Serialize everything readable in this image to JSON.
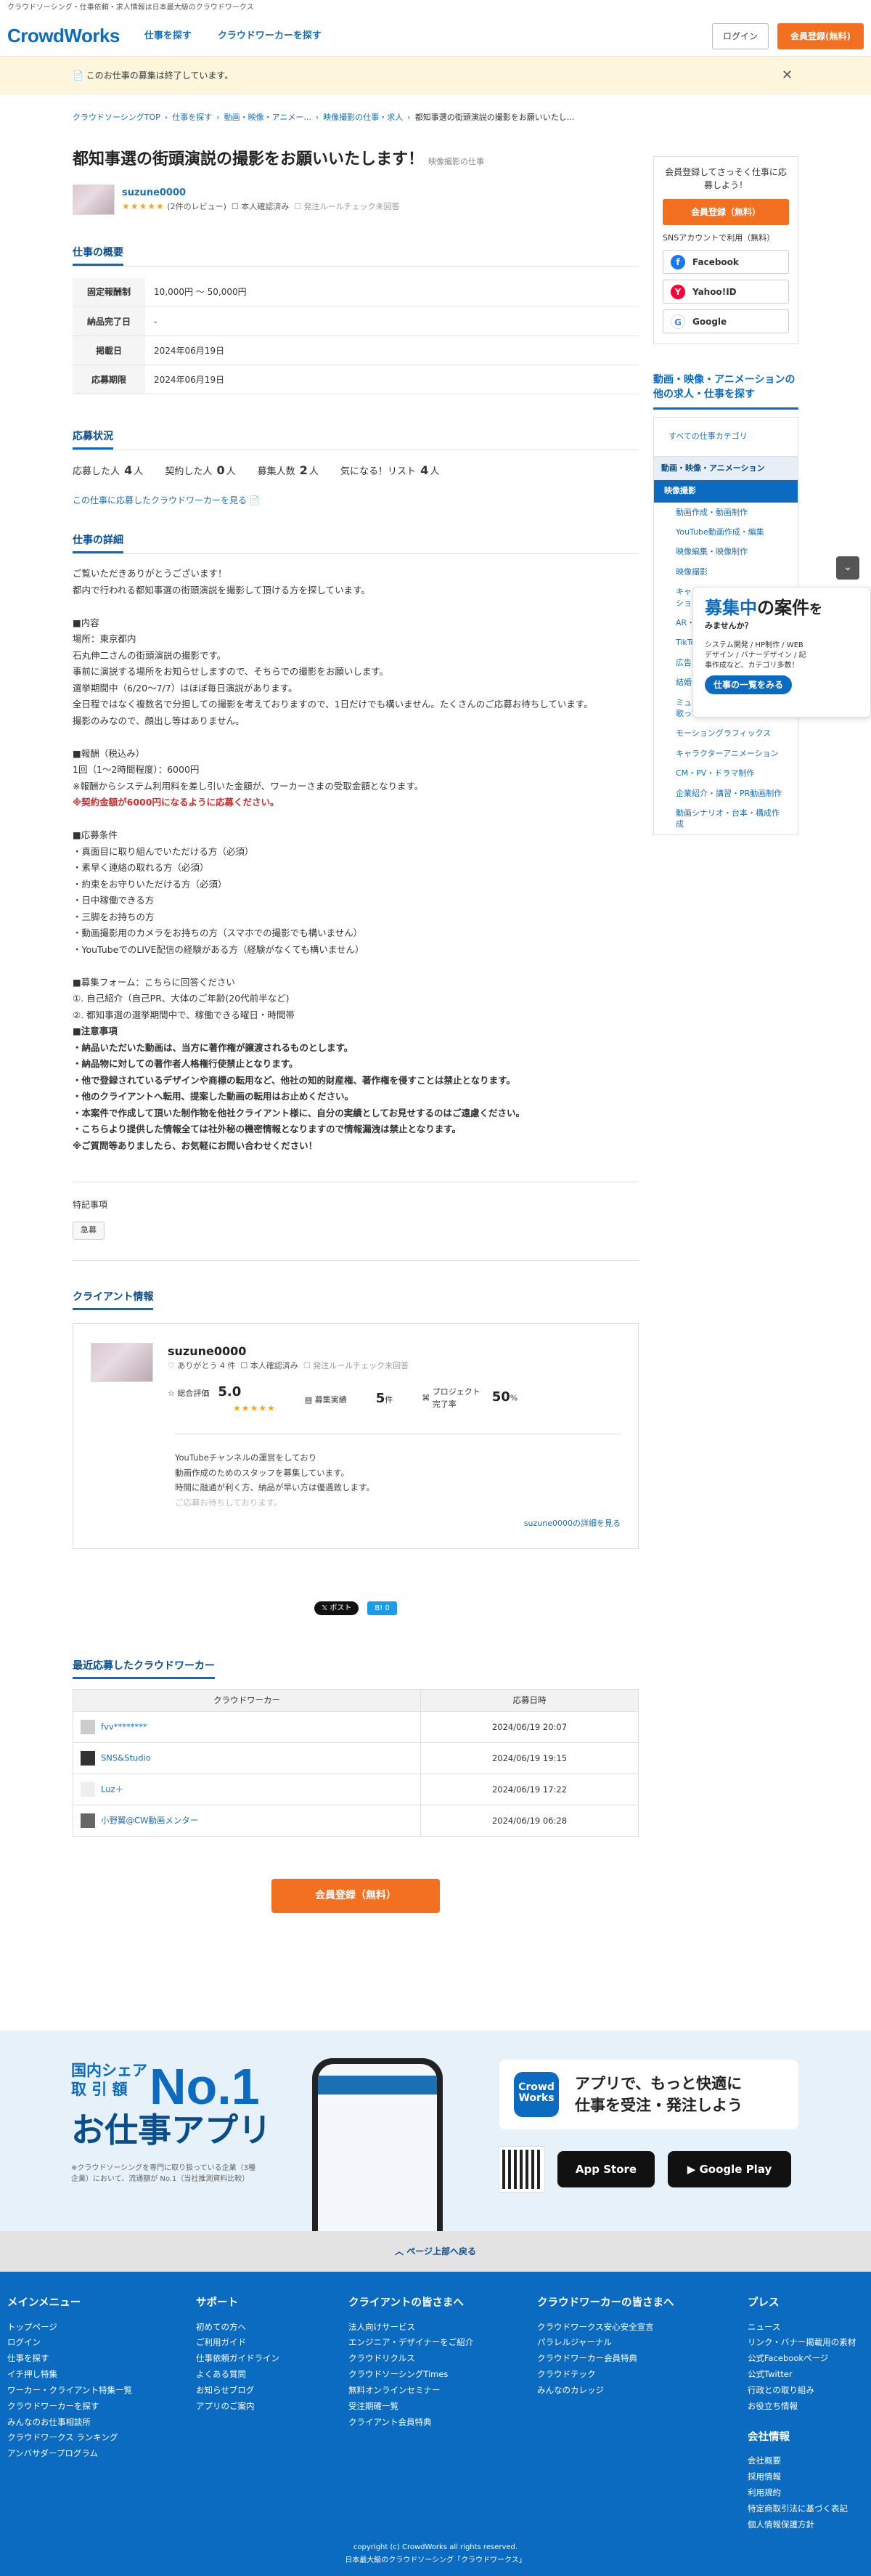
{
  "topbar": "クラウドソーシング・仕事依頼・求人情報は日本最大級のクラウドワークス",
  "header": {
    "logo": "CrowdWorks",
    "nav": [
      "仕事を探す",
      "クラウドワーカーを探す"
    ],
    "login": "ログイン",
    "register": "会員登録(無料)"
  },
  "notice": {
    "text": "📄 このお仕事の募集は終了しています。",
    "close": "✕"
  },
  "breadcrumb": [
    "クラウドソーシングTOP",
    "仕事を探す",
    "動画・映像・アニメー...",
    "映像撮影の仕事・求人",
    "都知事選の街頭演説の撮影をお願いいたし..."
  ],
  "job": {
    "title": "都知事選の街頭演説の撮影をお願いいたします！",
    "category": "映像撮影の仕事",
    "client": {
      "name": "suzune0000",
      "stars": "★★★★★",
      "reviews": "(2件のレビュー)",
      "verified": "本人確認済み",
      "rule": "発注ルールチェック未回答"
    }
  },
  "overview": {
    "title": "仕事の概要",
    "rows": [
      {
        "k": "固定報酬制",
        "v": "10,000円 〜 50,000円"
      },
      {
        "k": "納品完了日",
        "v": "-"
      },
      {
        "k": "掲載日",
        "v": "2024年06月19日"
      },
      {
        "k": "応募期限",
        "v": "2024年06月19日"
      }
    ]
  },
  "status": {
    "title": "応募状況",
    "applicants_label": "応募した人",
    "applicants": "4",
    "applicants_unit": "人",
    "contracted_label": "契約した人",
    "contracted": "0",
    "contracted_unit": "人",
    "recruit_label": "募集人数",
    "recruit": "2",
    "recruit_unit": "人",
    "fav_label": "気になる！リスト",
    "fav": "4",
    "fav_unit": "人",
    "link": "この仕事に応募したクラウドワーカーを見る 📄"
  },
  "detail": {
    "title": "仕事の詳細",
    "p1": "ご覧いただきありがとうございます！\n都内で行われる都知事選の街頭演説を撮影して頂ける方を探しています。\n\n■内容\n場所：東京都内\n石丸伸二さんの街頭演説の撮影です。\n事前に演説する場所をお知らせしますので、そちらでの撮影をお願いします。\n選挙期間中（6/20〜7/7）はほぼ毎日演説があります。\n全日程ではなく複数名で分担しての撮影を考えておりますので、1日だけでも構いません。たくさんのご応募お待ちしています。\n撮影のみなので、顔出し等はありません。\n\n■報酬（税込み）\n1回（1〜2時間程度）：6000円\n※報酬からシステム利用料を差し引いた金額が、ワーカーさまの受取金額となります。",
    "red": "※契約金額が6000円になるように応募ください。",
    "p2": "\n■応募条件\n・真面目に取り組んでいただける方（必須）\n・素早く連絡の取れる方（必須）\n・約束をお守りいただける方（必須）\n・日中稼働できる方\n・三脚をお持ちの方\n・動画撮影用のカメラをお持ちの方（スマホでの撮影でも構いません）\n・YouTubeでのLIVE配信の経験がある方（経験がなくても構いません）\n\n■募集フォーム：こちらに回答ください\n①. 自己紹介（自己PR、大体のご年齢(20代前半など)\n②. 都知事選の選挙期間中で、稼働できる曜日・時間帯\n",
    "p3": "■注意事項\n・納品いただいた動画は、当方に著作権が譲渡されるものとします。\n・納品物に対しての著作者人格権行使禁止となります。\n・他で登録されているデザインや商標の転用など、他社の知的財産権、著作権を侵すことは禁止となります。\n・他のクライアントへ転用、提案した動画の転用はお止めください。\n・本案件で作成して頂いた制作物を他社クライアント様に、自分の実績としてお見せするのはご遠慮ください。\n・こちらより提供した情報全ては社外秘の機密情報となりますので情報漏洩は禁止となります。\n※ご質問等ありましたら、お気軽にお問い合わせください！"
  },
  "special": {
    "label": "特記事項",
    "tag": "急募"
  },
  "clientinfo": {
    "title": "クライアント情報",
    "name": "suzune0000",
    "thanks": "ありがとう 4 件",
    "verified": "本人確認済み",
    "rule": "発注ルールチェック未回答",
    "rating_label": "総合評価",
    "rating": "5.0",
    "stars": "★★★★★",
    "posts_label": "募集実績",
    "posts": "5",
    "posts_unit": "件",
    "rate_label": "プロジェクト完了率",
    "rate": "50",
    "rate_unit": "%",
    "desc1": "YouTubeチャンネルの運営をしており",
    "desc2": "動画作成のためのスタッフを募集しています。",
    "desc3": "時間に融通が利く方、納品が早い方は優遇致します。",
    "desc4": "ご応募お待ちしております。",
    "more": "suzune0000の詳細を見る"
  },
  "share": {
    "x": "𝕏 ポスト",
    "b": "B! 0"
  },
  "recent": {
    "title": "最近応募したクラウドワーカー",
    "col1": "クラウドワーカー",
    "col2": "応募日時",
    "rows": [
      {
        "name": "fvv********",
        "date": "2024/06/19 20:07"
      },
      {
        "name": "SNS&Studio",
        "date": "2024/06/19 19:15"
      },
      {
        "name": "Luz＋",
        "date": "2024/06/19 17:22"
      },
      {
        "name": "小野翼@CW動画メンター",
        "date": "2024/06/19 06:28"
      }
    ]
  },
  "register_btn": "会員登録（無料）",
  "sidebar": {
    "card_text": "会員登録してさっそく仕事に応募しよう！",
    "card_btn": "会員登録（無料）",
    "sns_label": "SNSアカウントで利用（無料）",
    "facebook": "Facebook",
    "yahoo": "Yahoo!ID",
    "google": "Google",
    "cat_title": "動画・映像・アニメーションの他の求人・仕事を探す",
    "cat_all": "すべての仕事カテゴリ",
    "cat_head": "動画・映像・アニメーション",
    "cat_sel": "映像撮影",
    "cat_items": [
      "動画作成・動画制作",
      "YouTube動画作成・編集",
      "映像編集・映像制作",
      "映像撮影",
      "キャラクター制作・アニメーション",
      "AR・VR",
      "TikTok",
      "広告用動画制作",
      "結婚式・イベント動画",
      "ミュージックビデオ（MV）・歌ってみた動画",
      "モーショングラフィックス",
      "キャラクターアニメーション",
      "CM・PV・ドラマ制作",
      "企業紹介・講習・PR動画制作",
      "動画シナリオ・台本・構成作成"
    ]
  },
  "banner": {
    "l1a": "募集中",
    "l1b": "の案件",
    "l1c": "を",
    "l2": "みませんか？",
    "l3": "システム開発 / HP制作 / WEBデザイン / バナーデザイン / 記事作成など、カテゴリ多数！",
    "btn": "仕事の一覧をみる"
  },
  "app": {
    "tag1": "国内シェア",
    "tag2": "取 引 額",
    "no1": "No.1",
    "name": "お仕事アプリ",
    "note": "※クラウドソーシングを専門に取り扱っている企業（3種企業）において、流通額が No.1（当社推測資料比較）",
    "badge": "Crowd Works",
    "catch1": "アプリで、もっと快適に",
    "catch2": "仕事を受注・発注しよう",
    "appstore": " App Store",
    "gplay": "▶ Google Play"
  },
  "pagetop": "︿ ページ上部へ戻る",
  "footer": {
    "cols": [
      {
        "title": "メインメニュー",
        "items": [
          "トップページ",
          "ログイン",
          "仕事を探す",
          "イチ押し特集",
          "ワーカー・クライアント特集一覧",
          "クラウドワーカーを探す",
          "みんなのお仕事相談所",
          "クラウドワークス ランキング",
          "アンバサダープログラム"
        ]
      },
      {
        "title": "サポート",
        "items": [
          "初めての方へ",
          "ご利用ガイド",
          "仕事依頼ガイドライン",
          "よくある質問",
          "お知らせブログ",
          "アプリのご案内"
        ]
      },
      {
        "title": "クライアントの皆さまへ",
        "items": [
          "法人向けサービス",
          "エンジニア・デザイナーをご紹介",
          "クラウドリクルス",
          "クラウドソーシングTimes",
          "無料オンラインセミナー",
          "受注期確一覧",
          "クライアント会員特典"
        ]
      },
      {
        "title": "クラウドワーカーの皆さまへ",
        "items": [
          "クラウドワークス安心安全宣言",
          "パラレルジャーナル",
          "クラウドワーカー会員特典",
          "クラウドテック",
          "みんなのカレッジ"
        ]
      },
      {
        "title": "プレス",
        "items": [
          "ニュース",
          "リンク・バナー掲載用の素材",
          "公式Facebookページ",
          "公式Twitter",
          "行政との取り組み",
          "お役立ち情報"
        ]
      }
    ],
    "company_title": "会社情報",
    "company": [
      "会社概要",
      "採用情報",
      "利用規約",
      "特定商取引法に基づく表記",
      "個人情報保護方針"
    ],
    "copy1": "copyright (c) CrowdWorks all rights reserved.",
    "copy2": "日本最大級のクラウドソーシング「クラウドワークス」"
  }
}
